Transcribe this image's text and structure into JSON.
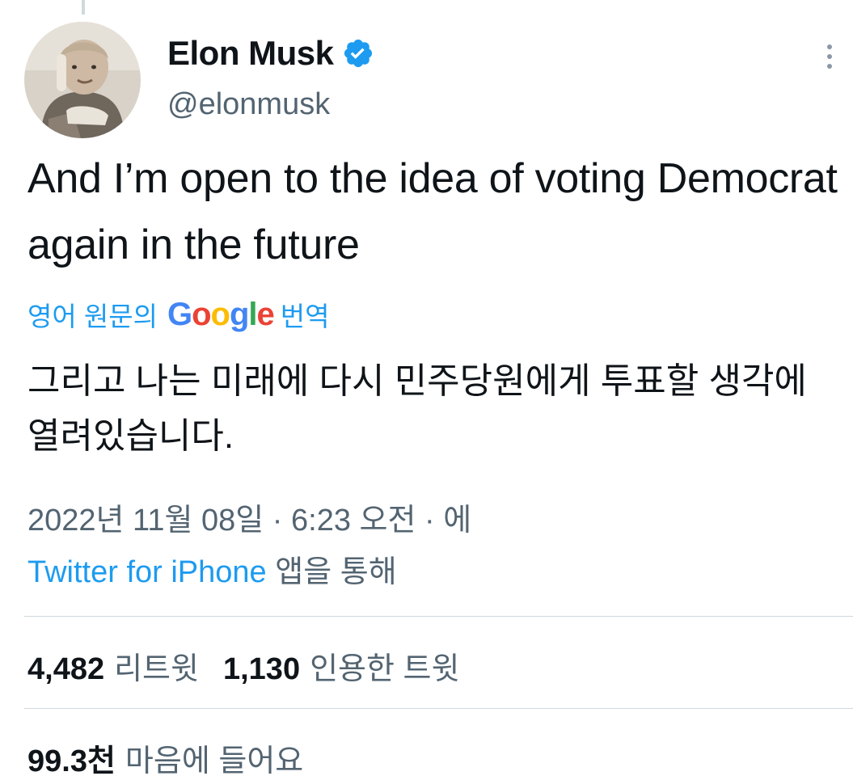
{
  "author": {
    "display_name": "Elon Musk",
    "handle": "@elonmusk",
    "verified": true,
    "avatar_icon": "avatar-photo"
  },
  "tweet": {
    "text": "And I’m open to the idea of voting Democrat again in the future"
  },
  "translation": {
    "prefix": "영어 원문의",
    "google_letters": [
      "G",
      "o",
      "o",
      "g",
      "l",
      "e"
    ],
    "suffix": "번역",
    "text": "그리고 나는 미래에 다시 민주당원에게 투표할 생각에 열려있습니다."
  },
  "meta": {
    "datetime": "2022년 11월 08일 · 6:23 오전 · 에",
    "source": "Twitter for iPhone",
    "source_suffix": "앱을 통해"
  },
  "stats": {
    "retweets_value": "4,482",
    "retweets_label": "리트윗",
    "quotes_value": "1,130",
    "quotes_label": "인용한 트윗",
    "likes_value": "99.3천",
    "likes_label": "마음에 들어요"
  },
  "colors": {
    "accent": "#1d9bf0",
    "text_primary": "#0f1419",
    "text_secondary": "#536471",
    "divider": "#cfd9de"
  },
  "icons": {
    "verified": "verified-badge-icon",
    "more": "more-vertical-icon"
  }
}
